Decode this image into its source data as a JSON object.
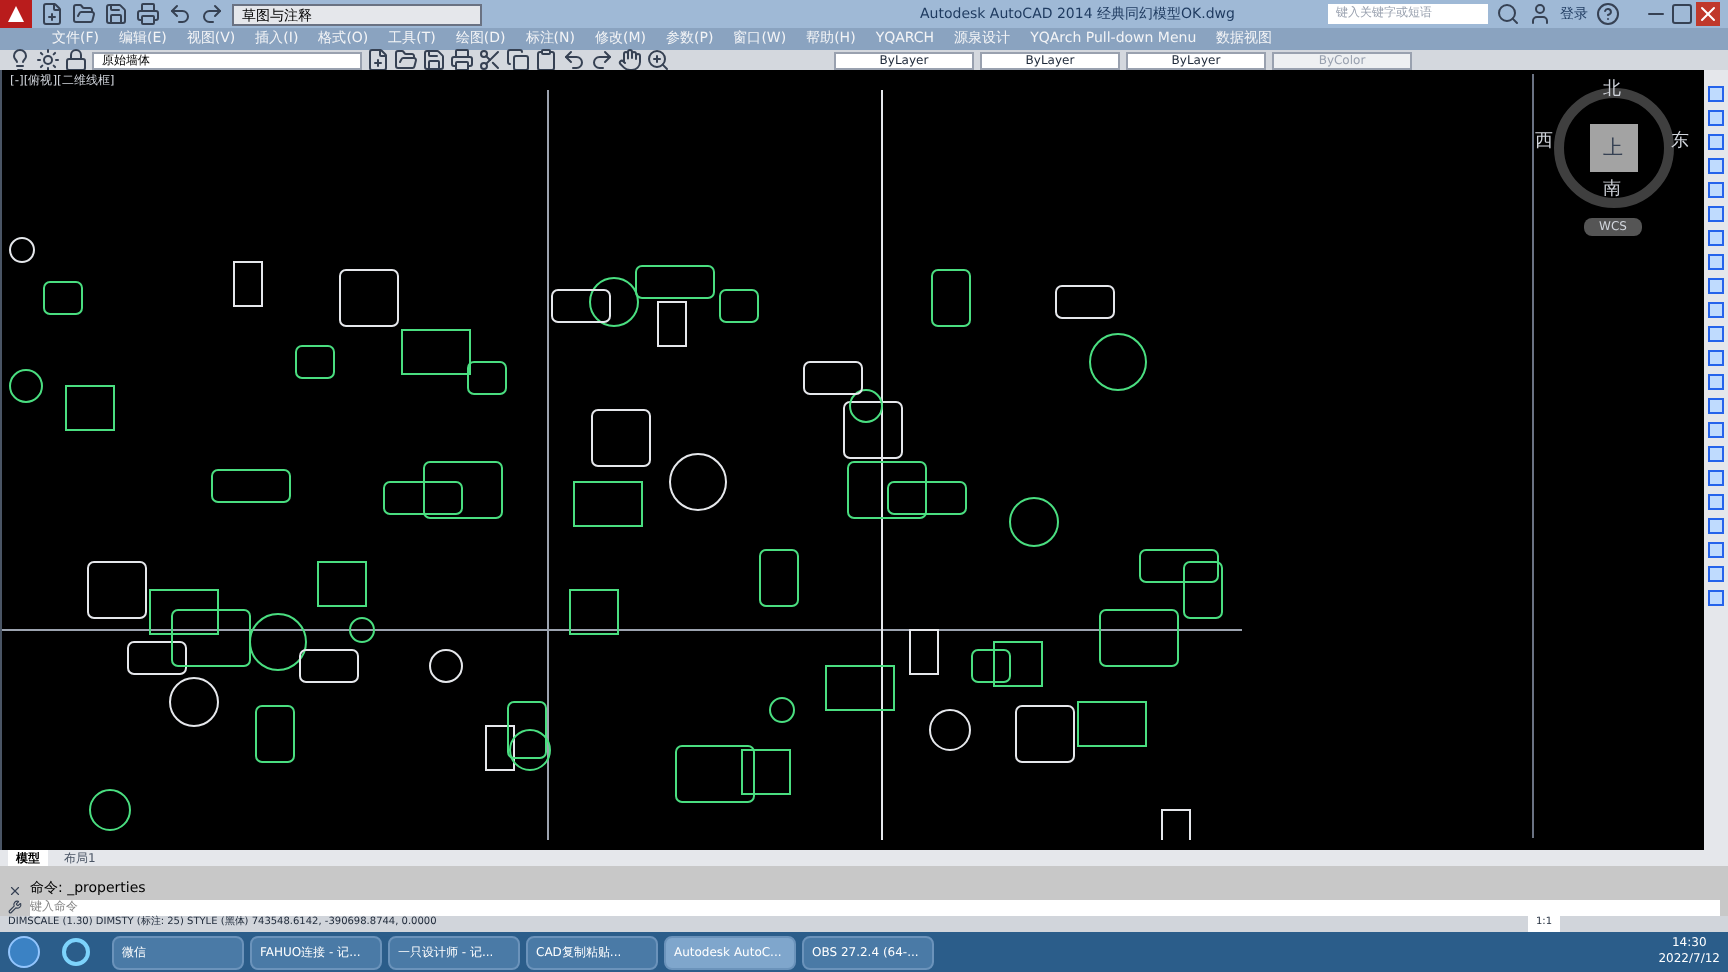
{
  "window": {
    "title": "Autodesk AutoCAD 2014    经典同幻模型OK.dwg",
    "workspace": "草图与注释",
    "search_placeholder": "键入关键字或短语",
    "login": "登录"
  },
  "menu": [
    "文件(F)",
    "编辑(E)",
    "视图(V)",
    "插入(I)",
    "格式(O)",
    "工具(T)",
    "绘图(D)",
    "标注(N)",
    "修改(M)",
    "参数(P)",
    "窗口(W)",
    "帮助(H)",
    "YQARCH",
    "源泉设计",
    "YQArch Pull-down Menu",
    "数据视图"
  ],
  "layer": "原始墙体",
  "properties": [
    "ByLayer",
    "ByLayer",
    "ByLayer",
    "ByColor"
  ],
  "viewport": {
    "label": "[-][俯视][二维线框]",
    "compass": {
      "north": "北",
      "east": "东",
      "south": "南",
      "west": "西",
      "top": "上",
      "ucs": "WCS"
    }
  },
  "layout_tabs": [
    {
      "label": "模型",
      "selected": true
    },
    {
      "label": "布局1",
      "selected": false
    }
  ],
  "command": {
    "history": "命令: _properties",
    "placeholder": "键入命令"
  },
  "status_bar": {
    "text": "DIMSCALE (1.30) DIMSTY (标注: 25) STYLE (黑体)  743548.6142, -390698.8744, 0.0000",
    "scale": "1:1"
  },
  "taskbar": {
    "items": [
      {
        "label": "微信",
        "selected": false
      },
      {
        "label": "FAHUO连接 - 记...",
        "selected": false
      },
      {
        "label": "一只设计师 - 记...",
        "selected": false
      },
      {
        "label": "CAD复制粘贴...",
        "selected": false
      },
      {
        "label": "Autodesk AutoC...",
        "selected": true
      },
      {
        "label": "OBS 27.2.4 (64-...",
        "selected": false
      }
    ],
    "time": "14:30",
    "date": "2022/7/12"
  }
}
